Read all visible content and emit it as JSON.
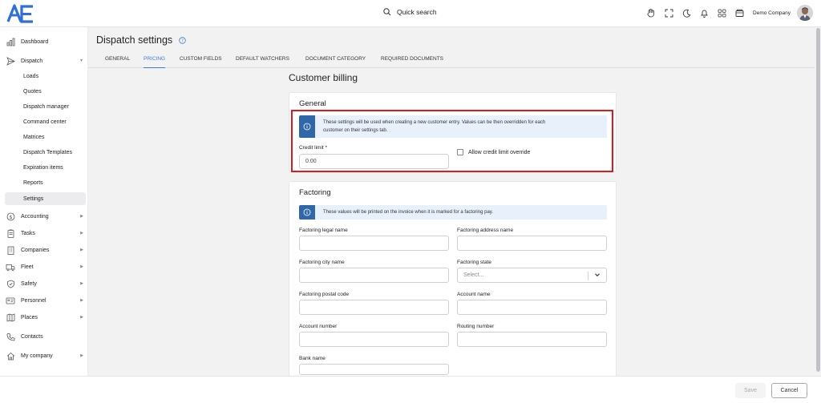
{
  "brand": {
    "logo_text": "AE",
    "logo_color": "#2f6fd6"
  },
  "topbar": {
    "search_label": "Quick search",
    "company": "Demo Company",
    "icons": [
      "hand-icon",
      "expand-icon",
      "moon-icon",
      "bell-icon",
      "apps-grid-icon",
      "wallet-icon"
    ]
  },
  "sidebar": {
    "dashboard": "Dashboard",
    "dispatch": "Dispatch",
    "dispatch_sub": [
      "Loads",
      "Quotes",
      "Dispatch manager",
      "Command center",
      "Matrices",
      "Dispatch Templates",
      "Expiration items",
      "Reports",
      "Settings"
    ],
    "accounting": "Accounting",
    "tasks": "Tasks",
    "companies": "Companies",
    "fleet": "Fleet",
    "safety": "Safety",
    "personnel": "Personnel",
    "places": "Places",
    "contacts": "Contacts",
    "my_company": "My company"
  },
  "page": {
    "title": "Dispatch settings",
    "tabs": [
      "GENERAL",
      "PRICING",
      "CUSTOM FIELDS",
      "DEFAULT WATCHERS",
      "DOCUMENT CATEGORY",
      "REQUIRED DOCUMENTS"
    ],
    "active_tab": "PRICING",
    "section_title": "Customer billing"
  },
  "general_card": {
    "title": "General",
    "info_line1": "These settings will be used when creating a new customer entry. Values can be then overridden for each",
    "info_line2": "customer on their settings tab.",
    "credit_limit_label": "Credit limit *",
    "credit_limit_value": "0.00",
    "allow_override_label": "Allow credit limit override",
    "allow_override_checked": false
  },
  "factoring_card": {
    "title": "Factoring",
    "info": "These values will be printed on the invoice when it is marked for a factoring pay.",
    "legal_name_label": "Factoring legal name",
    "address_name_label": "Factoring address name",
    "city_label": "Factoring city name",
    "state_label": "Factoring state",
    "state_placeholder": "Select...",
    "postal_label": "Factoring postal code",
    "account_name_label": "Account name",
    "account_number_label": "Account number",
    "routing_label": "Routing number",
    "bank_label": "Bank name"
  },
  "footer": {
    "save": "Save",
    "cancel": "Cancel"
  },
  "colors": {
    "accent": "#3f7ad6",
    "info_icon_bg": "#2f67a8",
    "info_bg": "#e8f0fb",
    "highlight": "#e0191c"
  }
}
